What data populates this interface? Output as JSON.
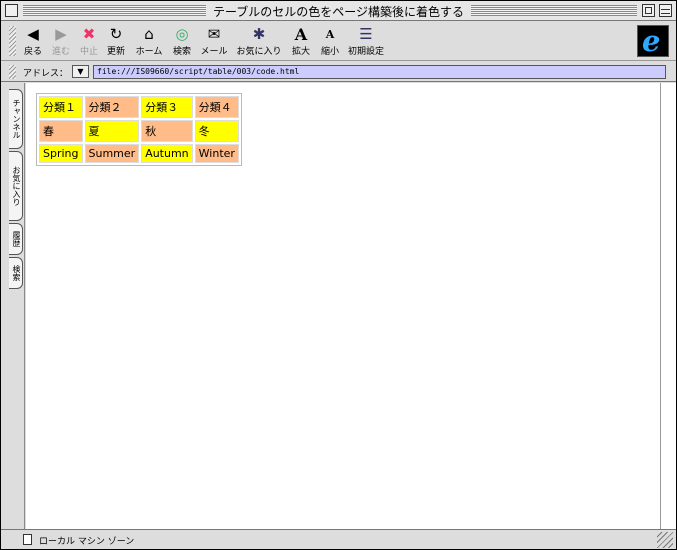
{
  "window": {
    "title": "テーブルのセルの色をページ構築後に着色する"
  },
  "toolbar": {
    "buttons": [
      {
        "label": "戻る",
        "icon": "back-arrow-icon",
        "glyph": "◀"
      },
      {
        "label": "進む",
        "icon": "forward-arrow-icon",
        "glyph": "▶"
      },
      {
        "label": "中止",
        "icon": "stop-icon",
        "glyph": "✖"
      },
      {
        "label": "更新",
        "icon": "refresh-icon",
        "glyph": "↻"
      },
      {
        "label": "ホーム",
        "icon": "home-icon",
        "glyph": "⌂"
      },
      {
        "label": "検索",
        "icon": "search-icon",
        "glyph": "◎"
      },
      {
        "label": "メール",
        "icon": "mail-icon",
        "glyph": "✉"
      },
      {
        "label": "お気に入り",
        "icon": "favorites-icon",
        "glyph": "✱"
      },
      {
        "label": "拡大",
        "icon": "text-larger-icon",
        "glyph": "A"
      },
      {
        "label": "縮小",
        "icon": "text-smaller-icon",
        "glyph": "A"
      },
      {
        "label": "初期設定",
        "icon": "preferences-icon",
        "glyph": "☰"
      }
    ]
  },
  "address": {
    "label": "アドレス：",
    "value": "file:///IS09660/script/table/003/code.html"
  },
  "sidetabs": [
    "チャンネル",
    "お気に入り",
    "履歴",
    "検索"
  ],
  "table": {
    "rows": [
      [
        "分類１",
        "分類２",
        "分類３",
        "分類４"
      ],
      [
        "春",
        "夏",
        "秋",
        "冬"
      ],
      [
        "Spring",
        "Summer",
        "Autumn",
        "Winter"
      ]
    ]
  },
  "status": {
    "text": "ローカル マシン ゾーン"
  },
  "colors": {
    "yellow": "#ffff00",
    "salmon": "#ffbb88",
    "address_bg": "#ccccff",
    "ie_logo": "#2fa8ff"
  }
}
